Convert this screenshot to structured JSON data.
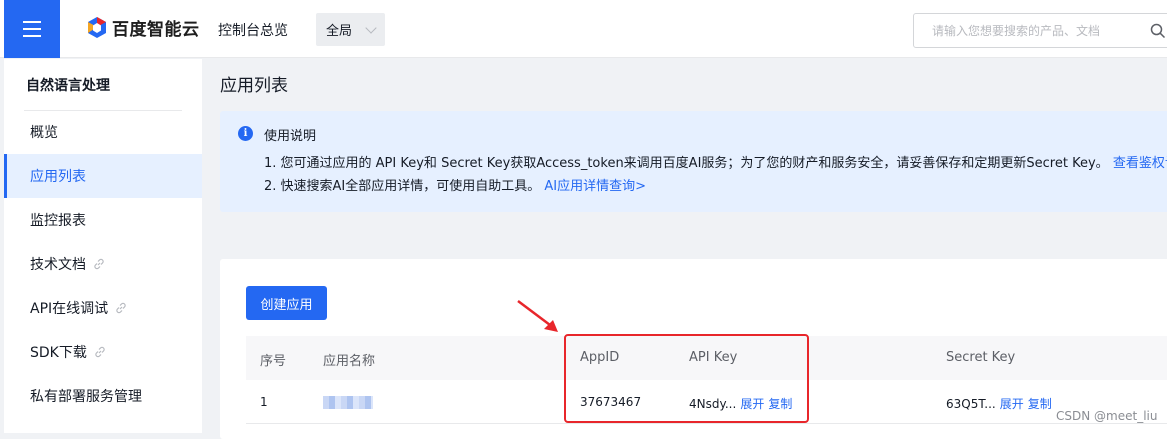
{
  "topbar": {
    "brand": "百度智能云",
    "console_link": "控制台总览",
    "region": "全局",
    "search_placeholder": "请输入您想要搜索的产品、文档"
  },
  "sidebar": {
    "title": "自然语言处理",
    "items": [
      {
        "label": "概览",
        "active": false,
        "external": false
      },
      {
        "label": "应用列表",
        "active": true,
        "external": false
      },
      {
        "label": "监控报表",
        "active": false,
        "external": false
      },
      {
        "label": "技术文档",
        "active": false,
        "external": true
      },
      {
        "label": "API在线调试",
        "active": false,
        "external": true
      },
      {
        "label": "SDK下载",
        "active": false,
        "external": true
      },
      {
        "label": "私有部署服务管理",
        "active": false,
        "external": false
      }
    ]
  },
  "main": {
    "page_title": "应用列表",
    "notice": {
      "title": "使用说明",
      "line1": "1. 您可通过应用的 API Key和 Secret Key获取Access_token来调用百度AI服务；为了您的财产和服务安全，请妥善保存和定期更新Secret Key。",
      "line1_link": "查看鉴权认",
      "line2": "2. 快速搜索AI全部应用详情，可使用自助工具。",
      "line2_link": "AI应用详情查询>"
    },
    "create_button": "创建应用",
    "table": {
      "headers": [
        "序号",
        "应用名称",
        "AppID",
        "API Key",
        "Secret Key"
      ],
      "rows": [
        {
          "index": "1",
          "name": "",
          "app_id": "37673467",
          "api_key": "4Nsdy...",
          "secret_key": "63Q5T...",
          "expand": "展开",
          "copy": "复制"
        }
      ]
    }
  },
  "watermark": "CSDN @meet_liu",
  "colors": {
    "accent": "#2468f2",
    "highlight": "#e8262b",
    "notice_bg": "#e6f0ff"
  }
}
